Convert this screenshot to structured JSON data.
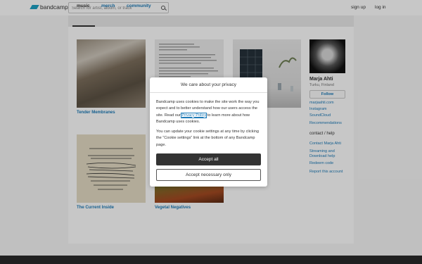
{
  "header": {
    "logo_text": "bandcamp",
    "search_placeholder": "Search for artist, album, or track",
    "signup_label": "sign up",
    "login_label": "log in"
  },
  "tabs": [
    {
      "label": "music",
      "active": true
    },
    {
      "label": "merch",
      "active": false
    },
    {
      "label": "community",
      "active": false
    }
  ],
  "albums": [
    {
      "title": "Tender Membranes"
    },
    {
      "title": ""
    },
    {
      "title": ""
    },
    {
      "title": "The Current Inside"
    },
    {
      "title": "Vegetal Negatives"
    }
  ],
  "artist": {
    "name": "Marja Ahti",
    "location": "Turku, Finland",
    "follow_label": "Follow",
    "links": [
      "marjaahti.com",
      "Instagram",
      "SoundCloud",
      "Recommendations"
    ],
    "contact_heading": "contact / help",
    "help_links": [
      "Contact Marja Ahti",
      "Streaming and Download help",
      "Redeem code",
      "Report this account"
    ]
  },
  "cookie_dialog": {
    "title": "We care about your privacy",
    "p1_before": "Bandcamp uses cookies to make the site work the way you expect and to better understand how our users access the site. Read our ",
    "policy_link": "Privacy Policy",
    "p1_after": " to learn more about how Bandcamp uses cookies.",
    "p2": "You can update your cookie settings at any time by clicking the “Cookie settings” link at the bottom of any Bandcamp page.",
    "accept_all_label": "Accept all",
    "accept_necessary_label": "Accept necessary only"
  },
  "colors": {
    "brand": "#1da0c3",
    "link": "#1d7bb8",
    "primary_button": "#333333"
  }
}
